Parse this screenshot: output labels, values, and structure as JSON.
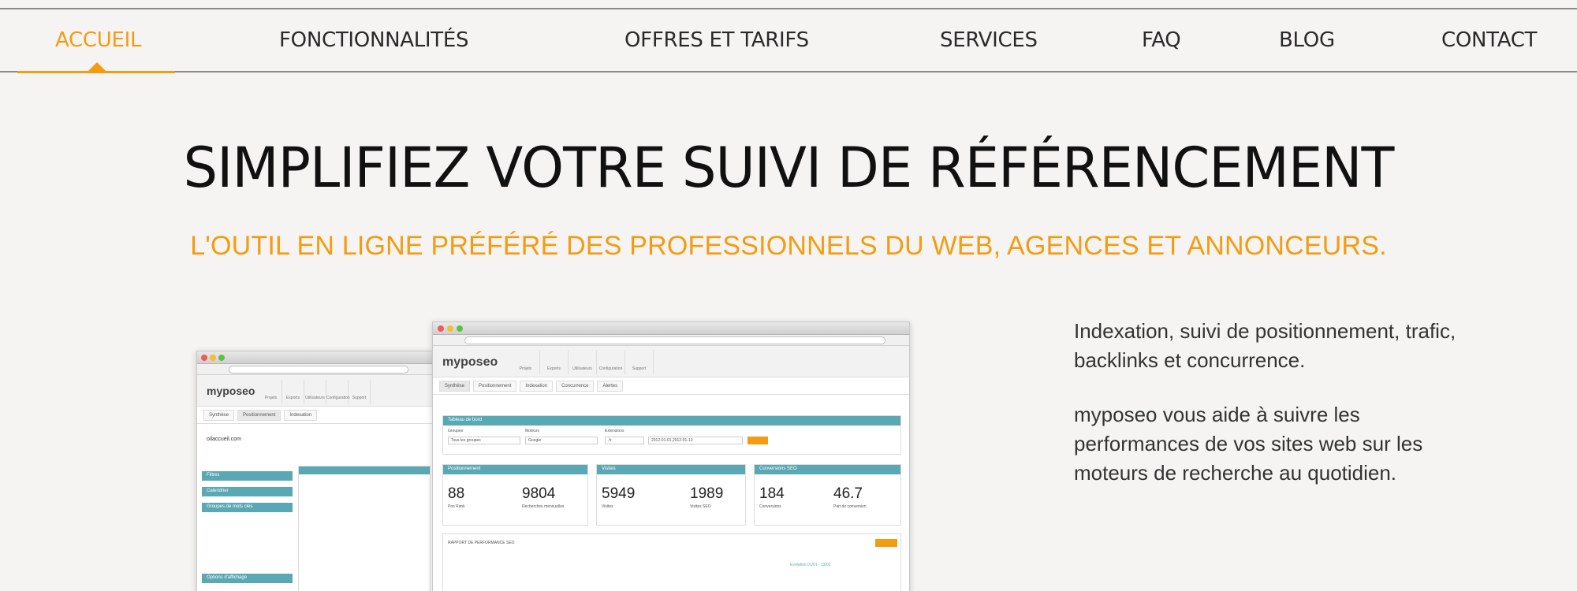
{
  "nav": {
    "items": [
      "ACCUEIL",
      "FONCTIONNALITÉS",
      "OFFRES ET TARIFS",
      "SERVICES",
      "FAQ",
      "BLOG",
      "CONTACT"
    ],
    "active_color": "#f39c12"
  },
  "hero": {
    "title": "SIMPLIFIEZ VOTRE SUIVI DE RÉFÉRENCEMENT",
    "subtitle": "L'OUTIL EN LIGNE PRÉFÉRÉ DES PROFESSIONNELS DU WEB, AGENCES ET ANNONCEURS."
  },
  "description": {
    "p1": "Indexation, suivi de positionnement, trafic, backlinks et concurrence.",
    "p2": "myposeo vous aide à suivre les performances de vos sites web sur les moteurs de recherche au quotidien."
  },
  "screenshot": {
    "logo_text": "myposeo",
    "back_site": "oilaccueil.com",
    "top_tabs": [
      "Projets",
      "Exports",
      "Utilisateurs",
      "Configuration",
      "Support"
    ],
    "sub_tabs": [
      "Synthèse",
      "Positionnement",
      "Indexation",
      "Concurrence",
      "Alertes"
    ],
    "dashboard_title": "Tableau de bord",
    "filters": [
      "Groupes",
      "Moteurs",
      "Extensions"
    ],
    "filter_values": [
      "Tous les groupes",
      "Google",
      ".fr",
      "2012-01-01,2012-01-13"
    ],
    "panels": [
      "Positionnement",
      "Visites",
      "Conversions SEO"
    ],
    "metrics": [
      {
        "value": "88",
        "label": "Pos Rank"
      },
      {
        "value": "9804",
        "label": "Recherches mensuelles"
      },
      {
        "value": "5949",
        "label": "Visites"
      },
      {
        "value": "1989",
        "label": "Visites SEO"
      },
      {
        "value": "184",
        "label": "Conversions"
      },
      {
        "value": "46.7",
        "label": "Part de conversion"
      }
    ],
    "side_boxes": [
      "Filtres",
      "Calendrier",
      "Groupes de mots clés",
      "Options d'affichage"
    ],
    "report_label": "RAPPORT DE PERFORMANCE SEO",
    "evolution_label": "Evolution 01/01 - 13/01"
  }
}
